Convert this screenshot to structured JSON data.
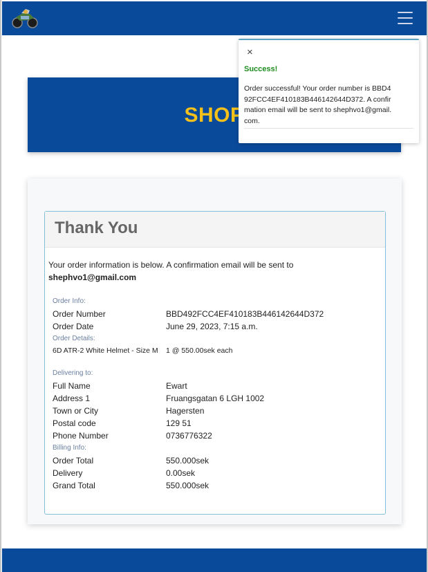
{
  "navbar": {
    "logo_icon": "motorcycle-logo-icon",
    "menu_icon": "hamburger-menu-icon",
    "color": "#0a4a9b"
  },
  "banner": {
    "title": "SHOP"
  },
  "toast": {
    "close_label": "×",
    "title": "Success!",
    "message": "Order successful! Your order number is BBD492FCC4EF410183B446142644D372. A confirmation email will be sent to shephvo1@gmail.com."
  },
  "checkout": {
    "heading": "Thank You",
    "intro_text": "Your order information is below. A confirmation email will be sent to",
    "email": "shephvo1@gmail.com",
    "order_info_label": "Order Info:",
    "order_number_label": "Order Number",
    "order_number": "BBD492FCC4EF410183B446142644D372",
    "order_date_label": "Order Date",
    "order_date": "June 29, 2023, 7:15 a.m.",
    "order_details_label": "Order Details:",
    "item_name": "6D ATR-2 White Helmet - Size M",
    "item_qty_price": "1 @ 550.00sek each",
    "delivering_label": "Delivering to:",
    "full_name_label": "Full Name",
    "full_name": "Ewart",
    "address1_label": "Address 1",
    "address1": "Fruangsgatan 6 LGH 1002",
    "town_label": "Town or City",
    "town": "Hagersten",
    "postal_label": "Postal code",
    "postal": "129 51",
    "phone_label": "Phone Number",
    "phone": "0736776322",
    "billing_label": "Billing Info:",
    "order_total_label": "Order Total",
    "order_total": "550.000sek",
    "delivery_label": "Delivery",
    "delivery": "0.00sek",
    "grand_total_label": "Grand Total",
    "grand_total": "550.000sek"
  }
}
